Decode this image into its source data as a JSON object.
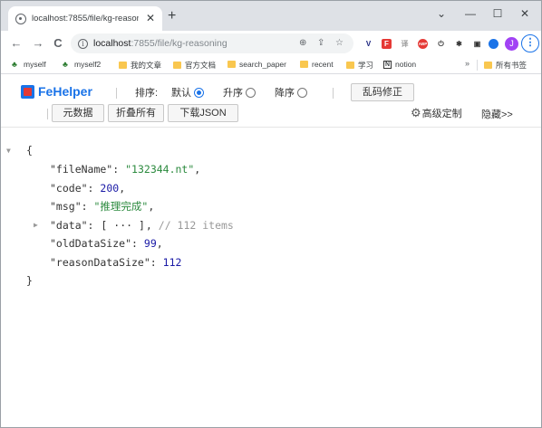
{
  "browser": {
    "tab_title": "localhost:7855/file/kg-reasoni",
    "tab_close": "✕",
    "new_tab": "+",
    "window_controls": {
      "chevron": "⌄",
      "minimize": "—",
      "maximize": "☐",
      "close": "✕"
    },
    "nav": {
      "back": "←",
      "forward": "→",
      "reload": "C"
    },
    "url_host": "localhost",
    "url_path": ":7855/file/kg-reasoning",
    "profile_initial": "J",
    "menu": "⋮",
    "extensions": [
      {
        "name": "v-ext",
        "glyph": "V",
        "color": "#1a237e"
      },
      {
        "name": "fehelper-ext",
        "glyph": "F",
        "color": "#e53935"
      },
      {
        "name": "translate-ext",
        "glyph": "译",
        "color": "#9e9e9e"
      },
      {
        "name": "abp-ext",
        "glyph": "ABP",
        "color": "#e53935"
      },
      {
        "name": "power-ext",
        "glyph": "⏻",
        "color": "#333333"
      },
      {
        "name": "puzzle-ext",
        "glyph": "✱",
        "color": "#333333"
      },
      {
        "name": "sidepanel-ext",
        "glyph": "▣",
        "color": "#333333"
      }
    ]
  },
  "bookmarks": {
    "items": [
      {
        "label": "myself",
        "kind": "tree"
      },
      {
        "label": "myself2",
        "kind": "tree"
      },
      {
        "label": "我的文章",
        "kind": "folder"
      },
      {
        "label": "官方文档",
        "kind": "folder"
      },
      {
        "label": "search_paper",
        "kind": "folder"
      },
      {
        "label": "recent",
        "kind": "folder"
      },
      {
        "label": "学习",
        "kind": "folder"
      },
      {
        "label": "notion",
        "kind": "notion"
      }
    ],
    "more": "»",
    "all_bookmarks": "所有书签"
  },
  "fehelper": {
    "brand": "FeHelper",
    "sort_label": "排序:",
    "sort_options": [
      {
        "label": "默认",
        "checked": true
      },
      {
        "label": "升序",
        "checked": false
      },
      {
        "label": "降序",
        "checked": false
      }
    ],
    "fix_button": "乱码修正",
    "raw_button": "元数据",
    "collapse_button": "折叠所有",
    "download_button": "下载JSON",
    "advanced": "高级定制",
    "hide": "隐藏>>"
  },
  "json_view": {
    "open_brace": "{",
    "close_brace": "}",
    "entries": [
      {
        "key": "\"fileName\"",
        "value": "\"132344.nt\"",
        "type": "string"
      },
      {
        "key": "\"code\"",
        "value": "200",
        "type": "number"
      },
      {
        "key": "\"msg\"",
        "value": "\"推理完成\"",
        "type": "string"
      },
      {
        "key": "\"data\"",
        "value": "[ ··· ]",
        "type": "collapsed",
        "comment": "// 112 items"
      },
      {
        "key": "\"oldDataSize\"",
        "value": "99",
        "type": "number"
      },
      {
        "key": "\"reasonDataSize\"",
        "value": "112",
        "type": "number"
      }
    ],
    "colon": ":",
    "comma": ","
  }
}
